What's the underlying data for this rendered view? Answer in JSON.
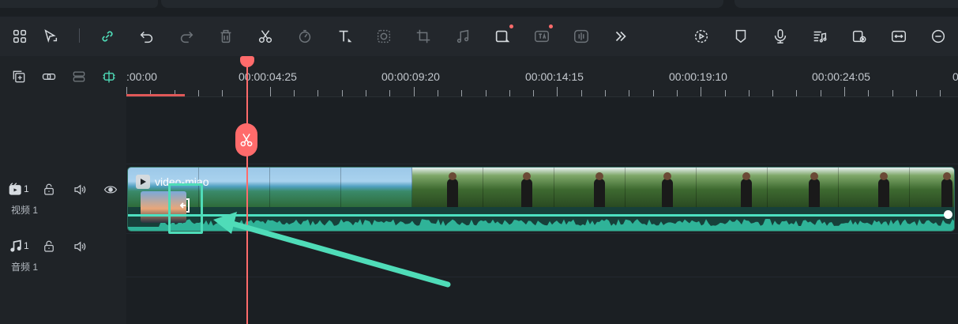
{
  "toolbar": {
    "buttons": [
      {
        "name": "grid-icon"
      },
      {
        "name": "select-tool-icon"
      },
      {
        "name": "link-icon"
      },
      {
        "name": "undo-icon"
      },
      {
        "name": "redo-icon"
      },
      {
        "name": "delete-icon"
      },
      {
        "name": "cut-icon"
      },
      {
        "name": "speed-icon"
      },
      {
        "name": "text-icon"
      },
      {
        "name": "mask-icon"
      },
      {
        "name": "crop-icon"
      },
      {
        "name": "audio-icon"
      },
      {
        "name": "frame-icon"
      },
      {
        "name": "ai-text-icon"
      },
      {
        "name": "voice-icon"
      },
      {
        "name": "more-icon"
      },
      {
        "name": "render-preview-icon"
      },
      {
        "name": "marker-icon"
      },
      {
        "name": "microphone-icon"
      },
      {
        "name": "audio-mixer-icon"
      },
      {
        "name": "preview-quality-icon"
      },
      {
        "name": "fit-timeline-icon"
      },
      {
        "name": "zoom-out-icon"
      }
    ]
  },
  "timeline": {
    "ruler_labels": [
      ":00:00",
      "00:00:04:25",
      "00:00:09:20",
      "00:00:14:15",
      "00:00:19:10",
      "00:00:24:05",
      "0"
    ],
    "tracks": {
      "video": {
        "number": "1",
        "label": "视频 1"
      },
      "audio": {
        "number": "1",
        "label": "音频 1"
      }
    },
    "clip": {
      "title": "video-miao"
    }
  },
  "colors": {
    "accent": "#4fdcb8",
    "playhead": "#ff6b6b",
    "background": "#1b1f23"
  }
}
